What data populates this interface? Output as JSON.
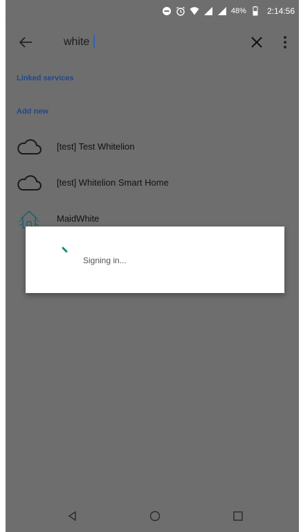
{
  "colors": {
    "overlay_bg": "#6e6e6e",
    "section_label": "#23488a",
    "caret": "#2f63b8",
    "spinner": "#1c8a7a",
    "dialog_bg": "#ffffff"
  },
  "status_bar": {
    "battery_percent": "48%",
    "time": "2:14:56",
    "icons": [
      "do-not-disturb-icon",
      "alarm-icon",
      "wifi-icon",
      "signal-icon",
      "signal-icon",
      "battery-icon"
    ]
  },
  "toolbar": {
    "back_icon": "arrow-back-icon",
    "search_value": "white",
    "clear_icon": "close-icon",
    "more_icon": "more-vert-icon"
  },
  "sections": {
    "linked_services": "Linked services",
    "add_new": "Add new"
  },
  "services": [
    {
      "label": "[test] Test Whitelion",
      "icon": "cloud-icon"
    },
    {
      "label": "[test] Whitelion Smart Home",
      "icon": "cloud-icon"
    },
    {
      "label": "MaidWhite",
      "icon": "house-icon"
    }
  ],
  "dialog": {
    "message": "Signing in..."
  },
  "nav_bar": {
    "back": "nav-back-icon",
    "home": "nav-home-icon",
    "recents": "nav-recents-icon"
  }
}
